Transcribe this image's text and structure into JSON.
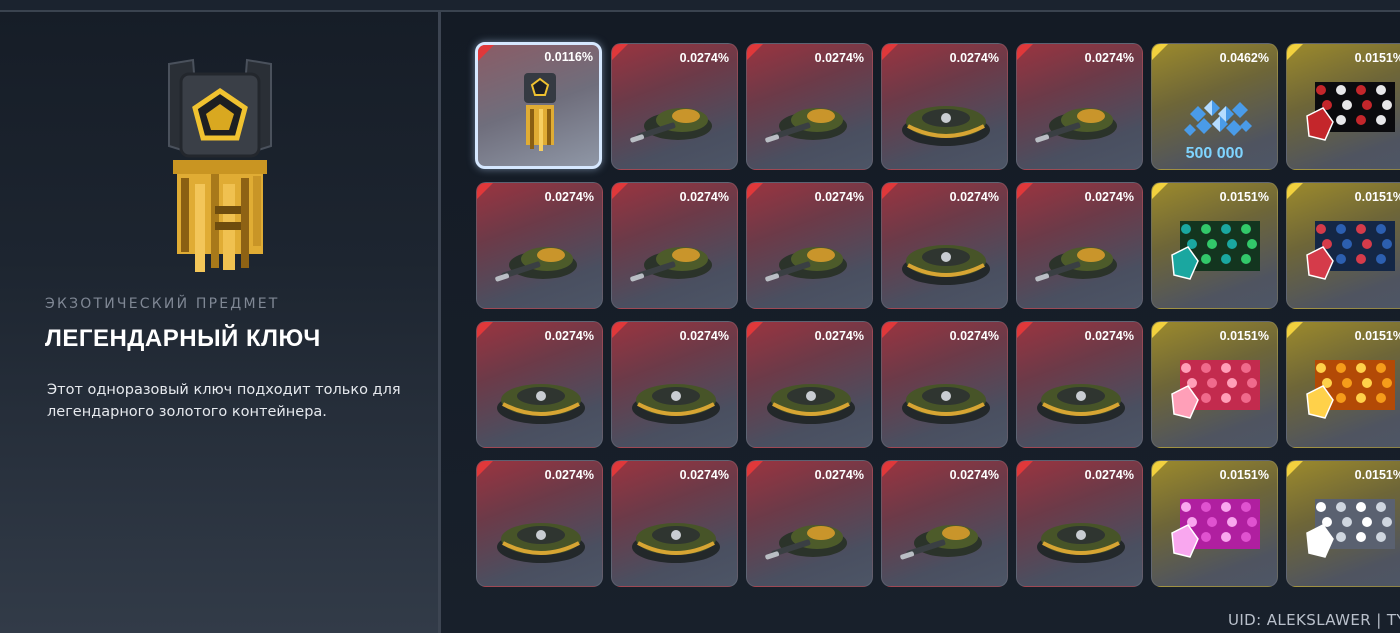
{
  "item": {
    "category": "ЭКЗОТИЧЕСКИЙ ПРЕДМЕТ",
    "title": "ЛЕГЕНДАРНЫЙ КЛЮЧ",
    "description": "Этот одноразовый ключ подходит только для легендарного золотого контейнера."
  },
  "grid": {
    "rows": [
      [
        {
          "chance": "0.0116%",
          "rarity": "legendary",
          "icon": "golden-key-icon",
          "selected": true
        },
        {
          "chance": "0.0274%",
          "rarity": "legendary",
          "icon": "turret-icon"
        },
        {
          "chance": "0.0274%",
          "rarity": "legendary",
          "icon": "turret-icon"
        },
        {
          "chance": "0.0274%",
          "rarity": "legendary",
          "icon": "hull-icon"
        },
        {
          "chance": "0.0274%",
          "rarity": "legendary",
          "icon": "turret-icon"
        },
        {
          "chance": "0.0462%",
          "rarity": "exotic",
          "icon": "crystals-icon",
          "amount": "500 000"
        },
        {
          "chance": "0.0151%",
          "rarity": "exotic",
          "icon": "paint-icon"
        }
      ],
      [
        {
          "chance": "0.0274%",
          "rarity": "legendary",
          "icon": "turret-icon"
        },
        {
          "chance": "0.0274%",
          "rarity": "legendary",
          "icon": "turret-icon"
        },
        {
          "chance": "0.0274%",
          "rarity": "legendary",
          "icon": "turret-icon"
        },
        {
          "chance": "0.0274%",
          "rarity": "legendary",
          "icon": "hull-icon"
        },
        {
          "chance": "0.0274%",
          "rarity": "legendary",
          "icon": "turret-icon"
        },
        {
          "chance": "0.0151%",
          "rarity": "exotic",
          "icon": "paint-icon"
        },
        {
          "chance": "0.0151%",
          "rarity": "exotic",
          "icon": "paint-icon"
        }
      ],
      [
        {
          "chance": "0.0274%",
          "rarity": "legendary",
          "icon": "hull-icon"
        },
        {
          "chance": "0.0274%",
          "rarity": "legendary",
          "icon": "hull-icon"
        },
        {
          "chance": "0.0274%",
          "rarity": "legendary",
          "icon": "hull-icon"
        },
        {
          "chance": "0.0274%",
          "rarity": "legendary",
          "icon": "hull-icon"
        },
        {
          "chance": "0.0274%",
          "rarity": "legendary",
          "icon": "hull-icon"
        },
        {
          "chance": "0.0151%",
          "rarity": "exotic",
          "icon": "paint-icon"
        },
        {
          "chance": "0.0151%",
          "rarity": "exotic",
          "icon": "paint-icon"
        }
      ],
      [
        {
          "chance": "0.0274%",
          "rarity": "legendary",
          "icon": "hull-icon"
        },
        {
          "chance": "0.0274%",
          "rarity": "legendary",
          "icon": "hull-icon"
        },
        {
          "chance": "0.0274%",
          "rarity": "legendary",
          "icon": "turret-icon"
        },
        {
          "chance": "0.0274%",
          "rarity": "legendary",
          "icon": "turret-icon"
        },
        {
          "chance": "0.0274%",
          "rarity": "legendary",
          "icon": "hull-icon"
        },
        {
          "chance": "0.0151%",
          "rarity": "exotic",
          "icon": "paint-icon"
        },
        {
          "chance": "0.0151%",
          "rarity": "exotic",
          "icon": "paint-icon"
        }
      ]
    ]
  },
  "footer": {
    "uid_text": "UID: ALEKSLAWER | TY"
  },
  "colors": {
    "legendary_corner": "#e0383a",
    "exotic_corner": "#f2d13e",
    "selected_border": "#d6e8ff",
    "crystal_amount": "#7fd4ff"
  }
}
